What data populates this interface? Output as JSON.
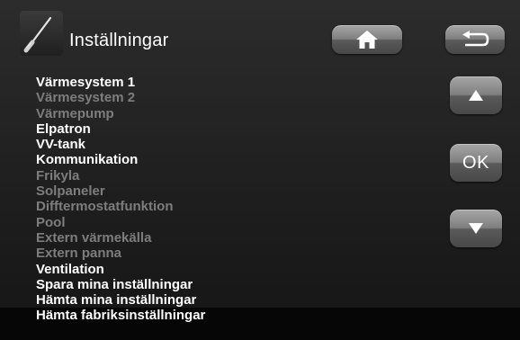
{
  "header": {
    "title": "Inställningar",
    "settings_icon": "screwdriver-icon"
  },
  "nav": {
    "home_icon": "home-icon",
    "back_icon": "back-arrow-icon"
  },
  "controls": {
    "up_icon": "triangle-up-icon",
    "ok_label": "OK",
    "down_icon": "triangle-down-icon"
  },
  "menu": [
    {
      "label": "Värmesystem 1",
      "enabled": true
    },
    {
      "label": "Värmesystem 2",
      "enabled": false
    },
    {
      "label": "Värmepump",
      "enabled": false
    },
    {
      "label": "Elpatron",
      "enabled": true
    },
    {
      "label": "VV-tank",
      "enabled": true
    },
    {
      "label": "Kommunikation",
      "enabled": true
    },
    {
      "label": "Frikyla",
      "enabled": false
    },
    {
      "label": "Solpaneler",
      "enabled": false
    },
    {
      "label": "Difftermostatfunktion",
      "enabled": false
    },
    {
      "label": "Pool",
      "enabled": false
    },
    {
      "label": "Extern värmekälla",
      "enabled": false
    },
    {
      "label": "Extern panna",
      "enabled": false
    },
    {
      "label": "Ventilation",
      "enabled": true
    },
    {
      "label": "Spara mina inställningar",
      "enabled": true
    },
    {
      "label": "Hämta mina inställningar",
      "enabled": true
    },
    {
      "label": "Hämta fabriksinställningar",
      "enabled": true
    }
  ],
  "colors": {
    "background": "#252525",
    "enabled_text": "#ffffff",
    "disabled_text": "#7d7d7d",
    "button_gradient_top": "#a6a6a6",
    "button_gradient_bottom": "#484848"
  }
}
